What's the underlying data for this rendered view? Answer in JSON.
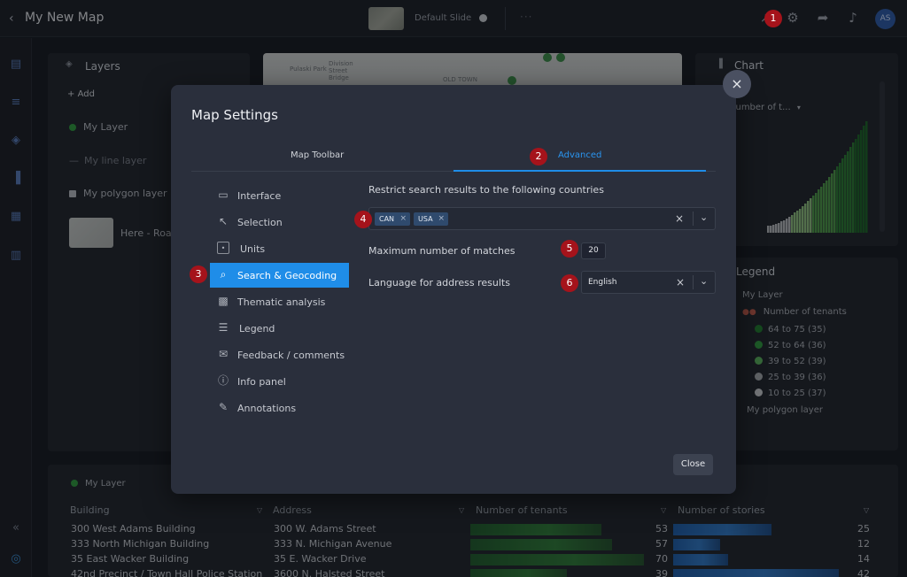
{
  "header": {
    "title": "My New Map",
    "slide_label": "Default Slide",
    "more": "···",
    "avatar_initials": "AS"
  },
  "layers_panel": {
    "title": "Layers",
    "add_label": "Add",
    "items": [
      "My Layer",
      "My line layer",
      "My polygon layer",
      "Here - Road"
    ]
  },
  "map": {
    "labels": [
      "Pulaski Park",
      "Division Street Bridge",
      "OLD TOWN"
    ]
  },
  "chart_panel": {
    "title": "Chart",
    "dropdown": "Number of t..."
  },
  "legend_panel": {
    "title": "Legend",
    "layer_name": "My Layer",
    "field": "Number of tenants",
    "items": [
      "64 to 75 (35)",
      "52 to 64 (36)",
      "39 to 52 (39)",
      "25 to 39 (36)",
      "10 to 25 (37)"
    ],
    "colors": [
      "#1f7a2d",
      "#2e9a3c",
      "#5ab35b",
      "#a7a9ad",
      "#c9cbce"
    ],
    "footer": "My polygon layer"
  },
  "table": {
    "layer_label": "My Layer",
    "columns": [
      "Building",
      "Address",
      "Number of tenants",
      "Number of stories"
    ],
    "rows": [
      {
        "building": "300 West Adams Building",
        "address": "300 W. Adams Street",
        "tenants": 53,
        "stories": 25
      },
      {
        "building": "333 North Michigan Building",
        "address": "333 N. Michigan Avenue",
        "tenants": 57,
        "stories": 12
      },
      {
        "building": "35 East Wacker Building",
        "address": "35 E. Wacker Drive",
        "tenants": 70,
        "stories": 14
      },
      {
        "building": "42nd Precinct / Town Hall Police Station",
        "address": "3600 N. Halsted Street",
        "tenants": 39,
        "stories": 42
      }
    ]
  },
  "modal": {
    "title": "Map Settings",
    "close_icon": "×",
    "tabs": [
      "Map Toolbar",
      "Advanced"
    ],
    "nav": [
      "Interface",
      "Selection",
      "Units",
      "Search & Geocoding",
      "Thematic analysis",
      "Legend",
      "Feedback / comments",
      "Info panel",
      "Annotations"
    ],
    "restrict_label": "Restrict search results to the following countries",
    "countries": [
      "CAN",
      "USA"
    ],
    "max_matches_label": "Maximum number of matches",
    "max_matches_value": "20",
    "language_label": "Language for address results",
    "language_value": "English",
    "close_button": "Close"
  },
  "badges": [
    "1",
    "2",
    "3",
    "4",
    "5",
    "6"
  ],
  "colors": {
    "accent": "#1f8de8",
    "badge": "#a5131b"
  }
}
